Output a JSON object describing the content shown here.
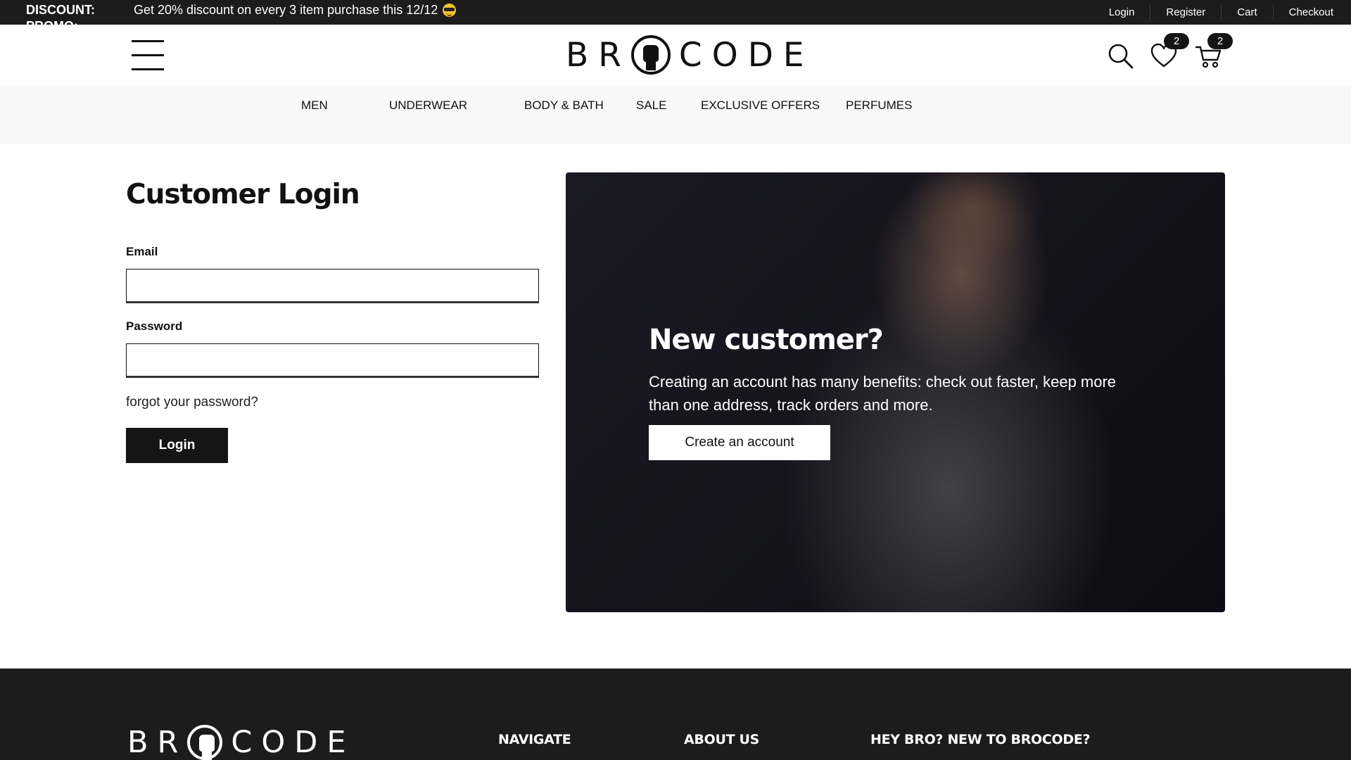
{
  "topbar": {
    "promo_label": "DISCOUNT:",
    "promo_text": "Get 20% discount on every 3 item purchase this 12/12",
    "promo_emoji": "sunglasses-emoji",
    "next_label": "PROMO:",
    "links": [
      "Login",
      "Register",
      "Cart",
      "Checkout"
    ]
  },
  "header": {
    "logo_left": "BR",
    "logo_right": "CODE",
    "wishlist_count": "2",
    "cart_count": "2"
  },
  "nav": {
    "items": [
      "MEN",
      "UNDERWEAR",
      "BODY & BATH",
      "SALE",
      "EXCLUSIVE OFFERS",
      "PERFUMES"
    ]
  },
  "login": {
    "title": "Customer Login",
    "email_label": "Email",
    "email_value": "",
    "password_label": "Password",
    "password_value": "",
    "forgot": "forgot your password?",
    "button": "Login"
  },
  "new_customer": {
    "title": "New customer?",
    "text": "Creating an account has many benefits: check out faster, keep more than one address, track orders and more.",
    "button": "Create an account"
  },
  "footer": {
    "logo_left": "BR",
    "logo_right": "CODE",
    "headings": [
      "NAVIGATE",
      "ABOUT US",
      "HEY BRO? NEW TO BROCODE?"
    ]
  },
  "colors": {
    "dark": "#1c1c1c",
    "nav_bg": "#f8f8f8",
    "accent": "#151515"
  }
}
